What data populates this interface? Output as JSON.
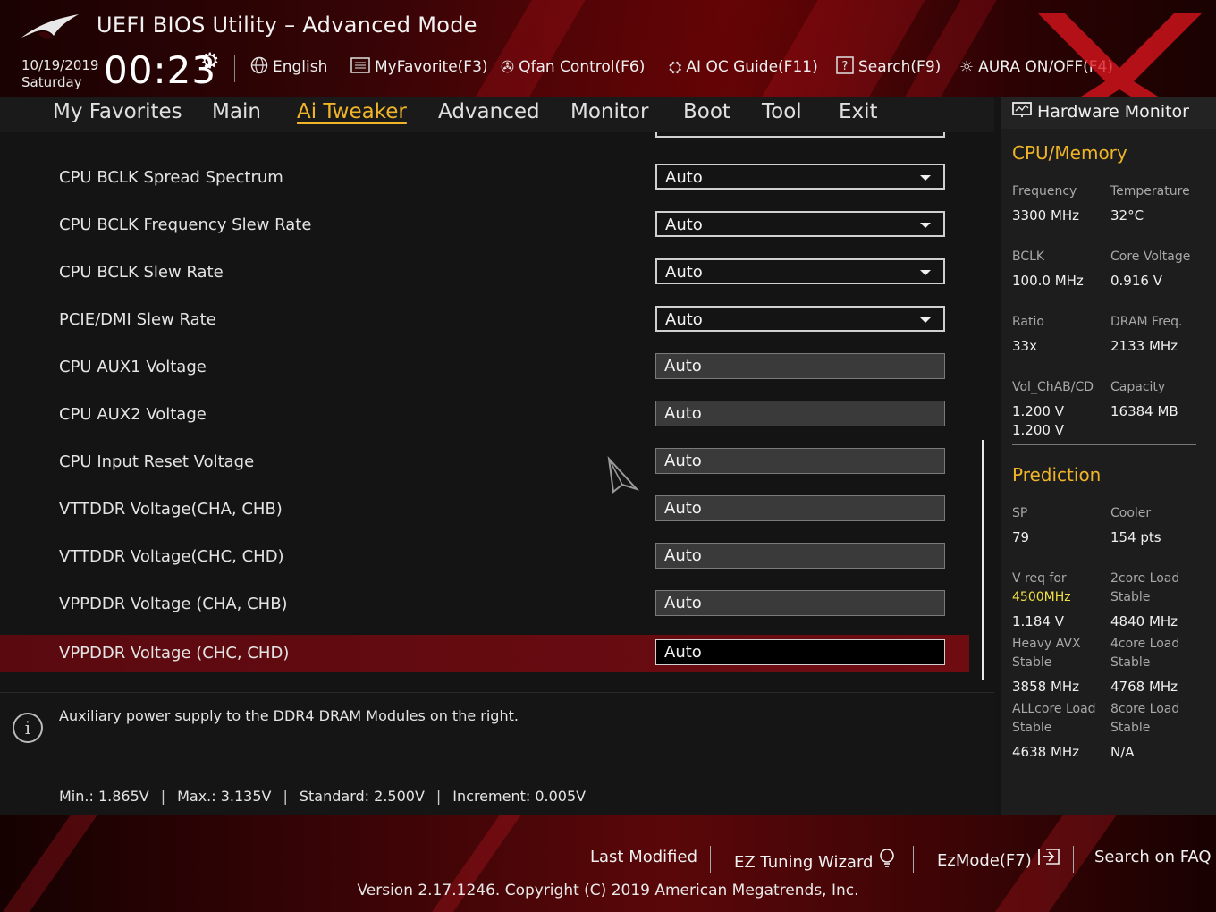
{
  "header": {
    "title": "UEFI BIOS Utility – Advanced Mode",
    "date": "10/19/2019",
    "day": "Saturday",
    "time": "00:23",
    "tools": [
      {
        "label": "English",
        "icon": "globe-icon"
      },
      {
        "label": "MyFavorite(F3)",
        "icon": "favorites-list-icon"
      },
      {
        "label": "Qfan Control(F6)",
        "icon": "fan-icon"
      },
      {
        "label": "AI OC Guide(F11)",
        "icon": "ai-chip-icon"
      },
      {
        "label": "Search(F9)",
        "icon": "help-search-icon"
      },
      {
        "label": "AURA ON/OFF(F4)",
        "icon": "aura-light-icon"
      }
    ]
  },
  "nav": {
    "tabs": [
      "My Favorites",
      "Main",
      "Ai Tweaker",
      "Advanced",
      "Monitor",
      "Boot",
      "Tool",
      "Exit"
    ],
    "active": "Ai Tweaker"
  },
  "settings": [
    {
      "label": "CPU BCLK Spread Spectrum",
      "value": "Auto",
      "kind": "dropdown"
    },
    {
      "label": "CPU BCLK Frequency Slew Rate",
      "value": "Auto",
      "kind": "dropdown"
    },
    {
      "label": "CPU BCLK Slew Rate",
      "value": "Auto",
      "kind": "dropdown"
    },
    {
      "label": "PCIE/DMI Slew Rate",
      "value": "Auto",
      "kind": "dropdown"
    },
    {
      "label": "CPU AUX1 Voltage",
      "value": "Auto",
      "kind": "input"
    },
    {
      "label": "CPU AUX2 Voltage",
      "value": "Auto",
      "kind": "input"
    },
    {
      "label": "CPU Input Reset Voltage",
      "value": "Auto",
      "kind": "input"
    },
    {
      "label": "VTTDDR Voltage(CHA, CHB)",
      "value": "Auto",
      "kind": "input"
    },
    {
      "label": "VTTDDR Voltage(CHC, CHD)",
      "value": "Auto",
      "kind": "input"
    },
    {
      "label": "VPPDDR Voltage (CHA, CHB)",
      "value": "Auto",
      "kind": "input"
    },
    {
      "label": "VPPDDR Voltage (CHC, CHD)",
      "value": "Auto",
      "kind": "input",
      "selected": true
    }
  ],
  "help": {
    "description": "Auxiliary power supply to the DDR4 DRAM Modules on the right.",
    "min": "Min.: 1.865V",
    "max": "Max.: 3.135V",
    "standard": "Standard: 2.500V",
    "increment": "Increment: 0.005V"
  },
  "hardware_monitor": {
    "title": "Hardware Monitor",
    "cpu_memory": {
      "title": "CPU/Memory",
      "frequency_label": "Frequency",
      "frequency": "3300 MHz",
      "temperature_label": "Temperature",
      "temperature": "32°C",
      "bclk_label": "BCLK",
      "bclk": "100.0 MHz",
      "core_voltage_label": "Core Voltage",
      "core_voltage": "0.916 V",
      "ratio_label": "Ratio",
      "ratio": "33x",
      "dram_freq_label": "DRAM Freq.",
      "dram_freq": "2133 MHz",
      "vol_label": "Vol_ChAB/CD",
      "vol_ab": "1.200 V",
      "vol_cd": "1.200 V",
      "capacity_label": "Capacity",
      "capacity": "16384 MB"
    },
    "prediction": {
      "title": "Prediction",
      "sp_label": "SP",
      "sp": "79",
      "cooler_label": "Cooler",
      "cooler": "154 pts",
      "vreq_label": "V req for",
      "vreq_freq": "4500MHz",
      "vreq": "1.184 V",
      "core2_label_1": "2core Load",
      "core2_label_2": "Stable",
      "core2": "4840 MHz",
      "avx_label_1": "Heavy AVX",
      "avx_label_2": "Stable",
      "avx": "3858 MHz",
      "core4_label_1": "4core Load",
      "core4_label_2": "Stable",
      "core4": "4768 MHz",
      "allcore_label_1": "ALLcore Load",
      "allcore_label_2": "Stable",
      "allcore": "4638 MHz",
      "core8_label_1": "8core Load",
      "core8_label_2": "Stable",
      "core8": "N/A"
    }
  },
  "footer": {
    "last_modified": "Last Modified",
    "ez_tuning": "EZ Tuning Wizard",
    "ez_mode": "EzMode(F7)",
    "search_faq": "Search on FAQ",
    "version": "Version 2.17.1246. Copyright (C) 2019 American Megatrends, Inc."
  },
  "colors": {
    "accent": "#f0b429",
    "selected_row": "#6e0c12",
    "highlight_value": "#f0e040"
  }
}
